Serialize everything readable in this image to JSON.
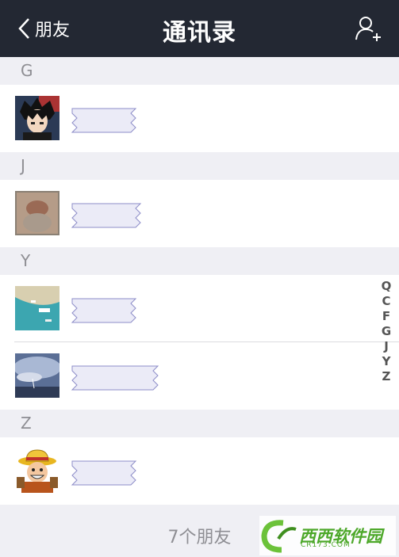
{
  "nav": {
    "back_label": "朋友",
    "title": "通讯录",
    "add_icon": "add-friend-icon"
  },
  "sections": [
    {
      "letter": "G",
      "contacts": [
        {
          "name": "",
          "avatar": "anime-boy-avatar"
        }
      ]
    },
    {
      "letter": "J",
      "contacts": [
        {
          "name": "",
          "avatar": "blurred-avatar"
        }
      ]
    },
    {
      "letter": "Y",
      "contacts": [
        {
          "name": "",
          "avatar": "beach-avatar"
        },
        {
          "name": "",
          "avatar": "sky-avatar"
        }
      ]
    },
    {
      "letter": "Z",
      "contacts": [
        {
          "name": "",
          "avatar": "cartoon-pirate-avatar"
        }
      ]
    }
  ],
  "index_bar": [
    "Q",
    "C",
    "F",
    "G",
    "J",
    "Y",
    "Z"
  ],
  "footer": {
    "count_text": "7个朋友"
  },
  "watermark": {
    "text": "西西软件园",
    "sub": "CR173.COM"
  }
}
